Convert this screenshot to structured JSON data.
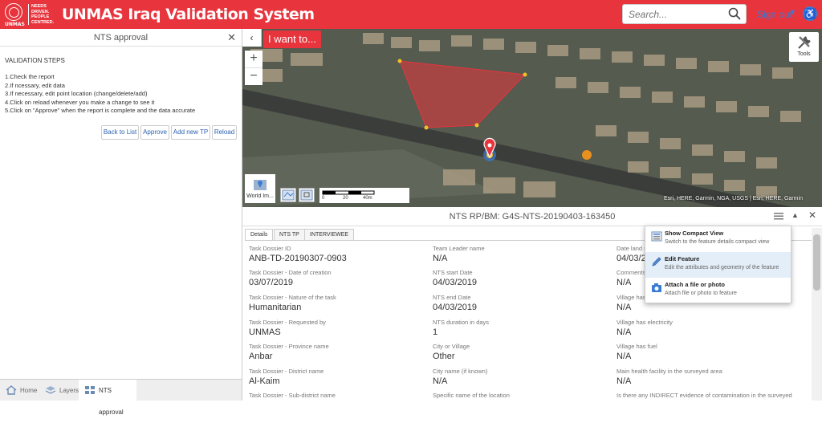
{
  "header": {
    "logo_brand": "UNMAS",
    "logo_tagline": "NEEDS DRIVEN. PEOPLE CENTRED.",
    "title": "UNMAS Iraq Validation System",
    "search_placeholder": "Search...",
    "sign_out": "Sign out",
    "accent_color": "#e8343d"
  },
  "left_panel": {
    "title": "NTS approval",
    "steps_title": "VALIDATION STEPS",
    "steps": [
      "1.Check the report",
      "2.If ncessary, edit data",
      "3.If necessary, edit point location (change/delete/add)",
      "4.Click on reload whenever you make a change to see it",
      "5.Click on \"Approve\" when the report is complete and the data accurate"
    ],
    "buttons": {
      "back": "Back to List",
      "approve": "Approve",
      "add_tp": "Add new TP",
      "reload": "Reload"
    },
    "footer_tabs": {
      "home": "Home",
      "layers": "Layers",
      "nts": "NTS approval"
    }
  },
  "map": {
    "i_want": "I want to...",
    "zoom_in": "+",
    "zoom_out": "−",
    "tools": "Tools",
    "basemap": "World Im...",
    "scale_labels": [
      "0",
      "20",
      "40m"
    ],
    "attribution": "Esri, HERE, Garmin, NGA, USGS | Esri, HERE, Garmin"
  },
  "detail": {
    "title": "NTS RP/BM: G4S-NTS-20190403-163450",
    "tabs": [
      "Details",
      "NTS TP",
      "INTERVIEWEE"
    ],
    "col1": [
      {
        "label": "Task Dossier ID",
        "value": "ANB-TD-20190307-0903"
      },
      {
        "label": "Task Dossier - Date of creation",
        "value": "03/07/2019"
      },
      {
        "label": "Task Dossier - Nature of the task",
        "value": "Humanitarian"
      },
      {
        "label": "Task Dossier - Requested by",
        "value": "UNMAS"
      },
      {
        "label": "Task Dossier - Province name",
        "value": "Anbar"
      },
      {
        "label": "Task Dossier - District name",
        "value": "Al-Kaim"
      },
      {
        "label": "Task Dossier - Sub-district name",
        "value": ""
      }
    ],
    "col2": [
      {
        "label": "Team Leader name",
        "value": "N/A"
      },
      {
        "label": "NTS start Date",
        "value": "04/03/2019"
      },
      {
        "label": "NTS end Date",
        "value": "04/03/2019"
      },
      {
        "label": "NTS duration in days",
        "value": "1"
      },
      {
        "label": "City or Village",
        "value": "Other"
      },
      {
        "label": "City name (if known)",
        "value": "N/A"
      },
      {
        "label": "Specific name of the location",
        "value": ""
      }
    ],
    "col3": [
      {
        "label": "Date land u",
        "value": "04/03/20"
      },
      {
        "label": "Comments",
        "value": "N/A"
      },
      {
        "label": "Village has",
        "value": "N/A"
      },
      {
        "label": "Village has electricity",
        "value": "N/A"
      },
      {
        "label": "Village has fuel",
        "value": "N/A"
      },
      {
        "label": "Main health facility in the surveyed area",
        "value": "N/A"
      },
      {
        "label": "Is there any INDIRECT evidence of contamination in the surveyed",
        "value": ""
      }
    ],
    "menu": [
      {
        "title": "Show Compact View",
        "desc": "Switch to the feature details compact view"
      },
      {
        "title": "Edit Feature",
        "desc": "Edit the attributes and geometry of the feature"
      },
      {
        "title": "Attach a file or photo",
        "desc": "Attach file or photo to feature"
      }
    ]
  }
}
